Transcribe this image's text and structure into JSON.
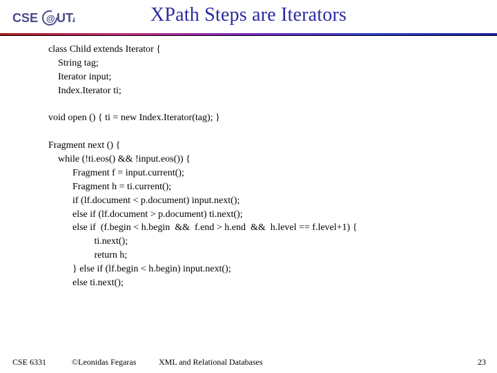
{
  "logo": {
    "text": "CSE",
    "alt": "CSE @ UTA logo"
  },
  "title": "XPath Steps are Iterators",
  "code": {
    "lines": [
      "class Child extends Iterator {",
      "    String tag;",
      "    Iterator input;",
      "    Index.Iterator ti;",
      "",
      "void open () { ti = new Index.Iterator(tag); }",
      "",
      "Fragment next () {",
      "    while (!ti.eos() && !input.eos()) {",
      "          Fragment f = input.current();",
      "          Fragment h = ti.current();",
      "          if (lf.document < p.document) input.next();",
      "          else if (lf.document > p.document) ti.next();",
      "          else if  (f.begin < h.begin  &&  f.end > h.end  &&  h.level == f.level+1) {",
      "                   ti.next();",
      "                   return h;",
      "          } else if (lf.begin < h.begin) input.next();",
      "          else ti.next();"
    ]
  },
  "footer": {
    "course": "CSE 6331",
    "copyright": "©Leonidas Fegaras",
    "center": "XML and Relational Databases",
    "page": "23"
  }
}
